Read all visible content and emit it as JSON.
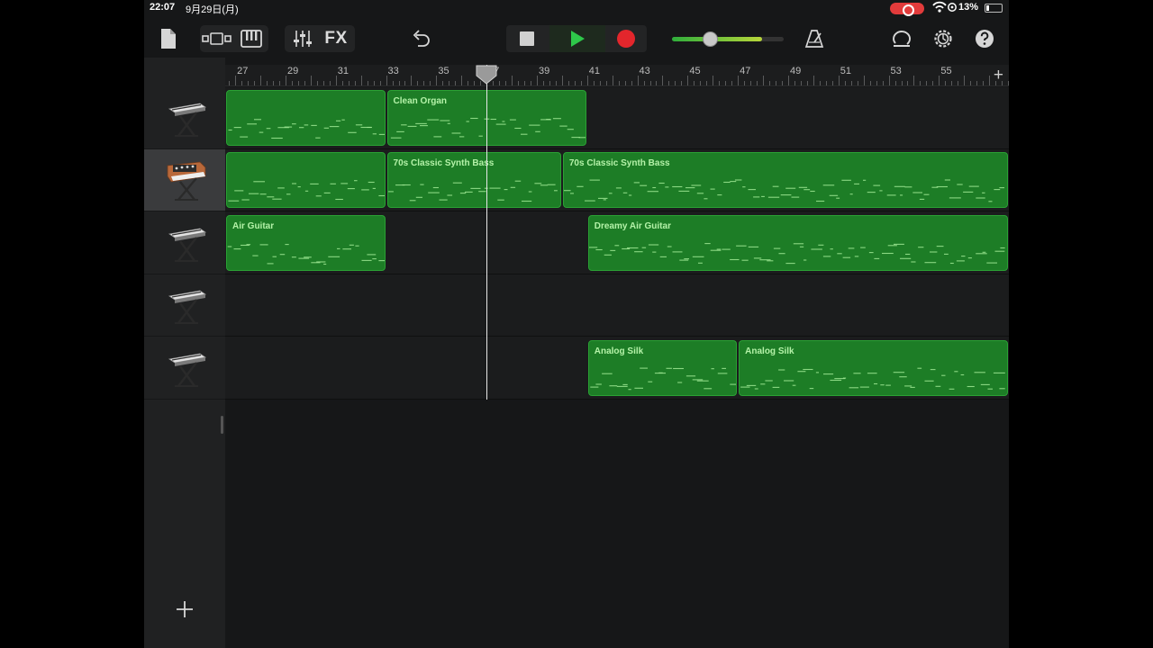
{
  "status_bar": {
    "time": "22:07",
    "date": "9月29日(月)",
    "battery_percent": "13%",
    "battery_level": 0.13,
    "recording_indicator": "screen-recording-pill",
    "accent_red": "#e23b3b"
  },
  "toolbar": {
    "fx_label": "FX",
    "volume_level": 0.34,
    "play_color": "#2ec84a",
    "record_color": "#e3262c"
  },
  "ruler": {
    "bars": [
      "27",
      "29",
      "31",
      "33",
      "35",
      "37",
      "39",
      "41",
      "43",
      "45",
      "47",
      "49",
      "51",
      "53",
      "55"
    ],
    "add_label": "+"
  },
  "tracks": [
    {
      "name": "track-1",
      "instrument_icon": "keyboard-stand-icon",
      "selected": false,
      "regions": [
        {
          "label": "",
          "start_bar": 26.6,
          "end_bar": 33.0
        },
        {
          "label": "Clean Organ",
          "start_bar": 33.0,
          "end_bar": 41.0
        }
      ]
    },
    {
      "name": "track-2",
      "instrument_icon": "analog-synth-icon",
      "selected": true,
      "regions": [
        {
          "label": "",
          "start_bar": 26.6,
          "end_bar": 33.0
        },
        {
          "label": "70s Classic Synth Bass",
          "start_bar": 33.0,
          "end_bar": 40.0
        },
        {
          "label": "70s Classic Synth Bass",
          "start_bar": 40.0,
          "end_bar": 57.9
        }
      ]
    },
    {
      "name": "track-3",
      "instrument_icon": "keyboard-stand-icon",
      "selected": false,
      "regions": [
        {
          "label": "Air Guitar",
          "start_bar": 26.6,
          "end_bar": 33.0
        },
        {
          "label": "Dreamy Air Guitar",
          "start_bar": 41.0,
          "end_bar": 57.9
        }
      ]
    },
    {
      "name": "track-4",
      "instrument_icon": "keyboard-stand-icon",
      "selected": false,
      "regions": []
    },
    {
      "name": "track-5",
      "instrument_icon": "keyboard-stand-icon",
      "selected": false,
      "regions": [
        {
          "label": "Analog Silk",
          "start_bar": 41.0,
          "end_bar": 47.0
        },
        {
          "label": "Analog Silk",
          "start_bar": 47.0,
          "end_bar": 57.9
        }
      ]
    }
  ],
  "playhead_bar": 37.0,
  "add_track_label": "+",
  "region_color": "#1d7d26"
}
